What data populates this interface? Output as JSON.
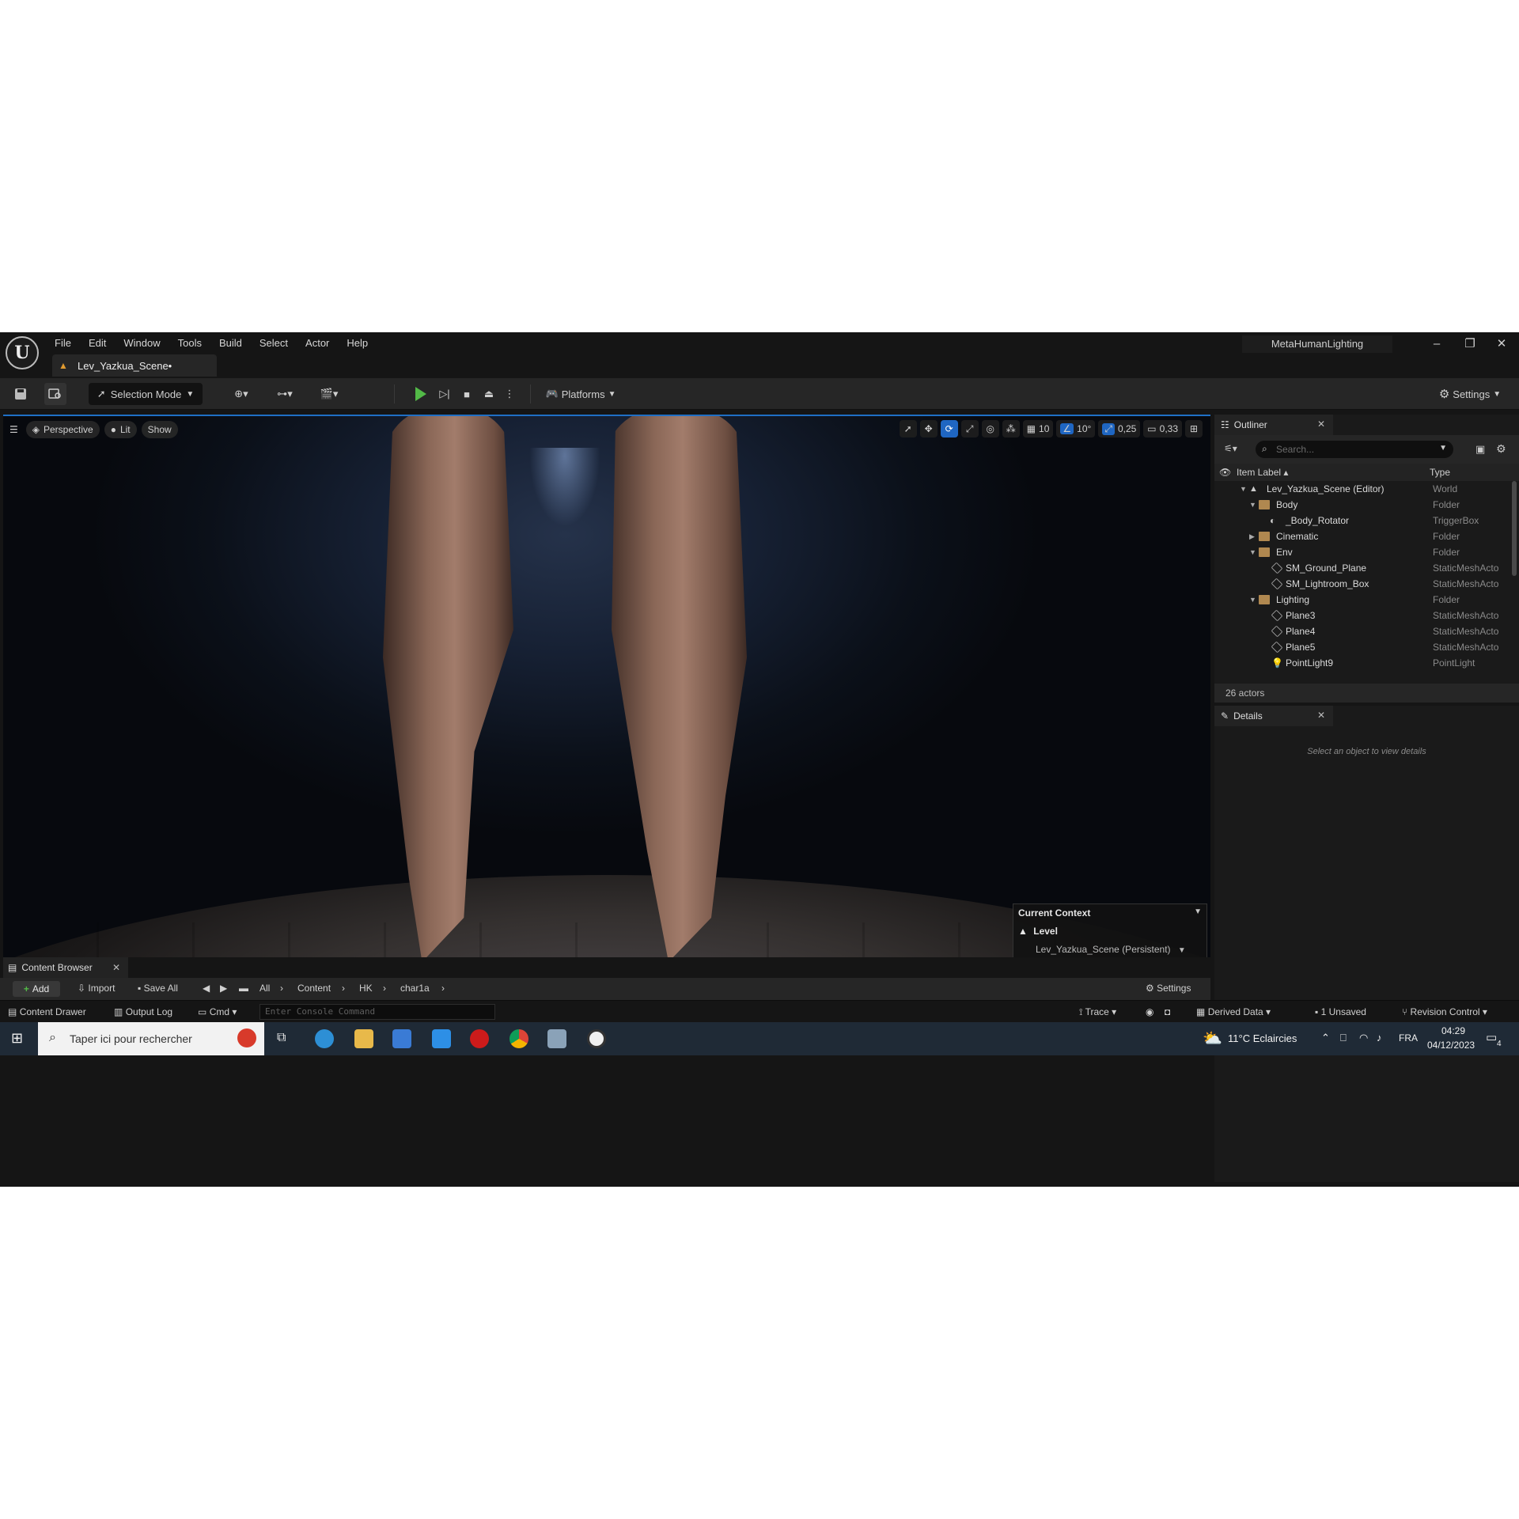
{
  "app": {
    "logo": "U",
    "menu": [
      "File",
      "Edit",
      "Window",
      "Tools",
      "Build",
      "Select",
      "Actor",
      "Help"
    ],
    "document_tab": "Lev_Yazkua_Scene•",
    "project_name": "MetaHumanLighting",
    "window_controls": {
      "minimize": "–",
      "restore": "❐",
      "close": "✕"
    }
  },
  "toolbar": {
    "selection_mode": "Selection Mode",
    "platforms": "Platforms",
    "settings": "Settings"
  },
  "viewport": {
    "perspective": "Perspective",
    "lit": "Lit",
    "show": "Show",
    "grid_snap": "10",
    "rotation_snap": "10°",
    "scale_snap": "0,25",
    "camera_speed": "0,33",
    "context": {
      "title": "Current Context",
      "level_label": "Level",
      "level_name": "Lev_Yazkua_Scene (Persistent)"
    }
  },
  "outliner": {
    "tab": "Outliner",
    "search_placeholder": "Search...",
    "col_label": "Item Label",
    "col_type": "Type",
    "rows": [
      {
        "label": "Lev_Yazkua_Scene (Editor)",
        "type": "World"
      },
      {
        "label": "Body",
        "type": "Folder"
      },
      {
        "label": "_Body_Rotator",
        "type": "TriggerBox"
      },
      {
        "label": "Cinematic",
        "type": "Folder"
      },
      {
        "label": "Env",
        "type": "Folder"
      },
      {
        "label": "SM_Ground_Plane",
        "type": "StaticMeshActo"
      },
      {
        "label": "SM_Lightroom_Box",
        "type": "StaticMeshActo"
      },
      {
        "label": "Lighting",
        "type": "Folder"
      },
      {
        "label": "Plane3",
        "type": "StaticMeshActo"
      },
      {
        "label": "Plane4",
        "type": "StaticMeshActo"
      },
      {
        "label": "Plane5",
        "type": "StaticMeshActo"
      },
      {
        "label": "PointLight9",
        "type": "PointLight"
      }
    ],
    "actor_count": "26 actors"
  },
  "details": {
    "tab": "Details",
    "empty_message": "Select an object to view details"
  },
  "content_browser": {
    "tab": "Content Browser",
    "add": "Add",
    "import": "Import",
    "save_all": "Save All",
    "path": [
      "All",
      "Content",
      "HK",
      "char1a"
    ],
    "settings": "Settings"
  },
  "statusbar": {
    "content_drawer": "Content Drawer",
    "output_log": "Output Log",
    "cmd": "Cmd",
    "console_placeholder": "Enter Console Command",
    "trace": "Trace",
    "derived_data": "Derived Data",
    "unsaved": "1 Unsaved",
    "revision_control": "Revision Control"
  },
  "taskbar": {
    "search_text": "Taper ici pour rechercher",
    "weather": "11°C  Eclaircies",
    "language": "FRA",
    "time": "04:29",
    "date": "04/12/2023",
    "notifications": "4"
  },
  "colors": {
    "accent_blue": "#1f66c2",
    "play_green": "#52b947",
    "folder": "#b08850"
  }
}
